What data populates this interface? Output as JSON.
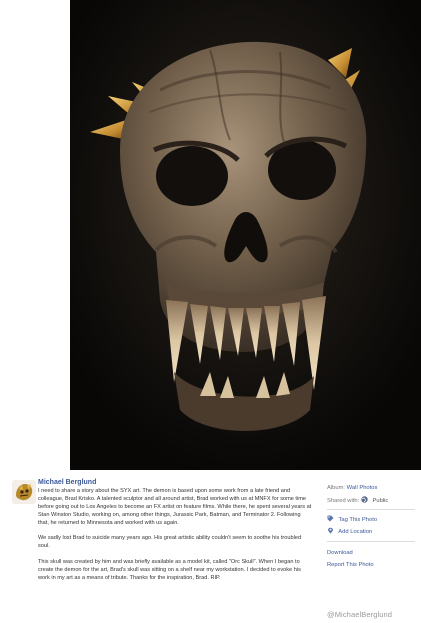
{
  "post": {
    "author": "Michael Berglund",
    "paragraphs": [
      "I need to share a story about the SYX art. The demon is based upon some work from a late friend and colleague, Brad Krisko. A talented sculptor and all around artist, Brad worked with us at MNFX for some time before going out to Los Angeles to become an FX artist on feature films. While there, he spent several years at Stan Winston Studio, working on, among other things, Jurassic Park, Batman, and Terminator 2. Following that, he returned to Minnesota and worked with us again.",
      "We sadly lost Brad to suicide many years ago. His great artistic ability couldn't seem to soothe his troubled soul.",
      "This skull was created by him and was briefly available as a model kit, called \"Orc Skull\". When I began to create the demon for the art, Brad's skull was sitting on a shelf near my workstation. I decided to evoke his work in my art as a means of tribute. Thanks for the inspiration, Brad. RIP."
    ]
  },
  "sidebar": {
    "album_label": "Album:",
    "album_value": "Wall Photos",
    "shared_label": "Shared with:",
    "shared_value": "Public",
    "tag_photo": "Tag This Photo",
    "add_location": "Add Location",
    "download": "Download",
    "report": "Report This Photo"
  },
  "watermark": "@MichaelBerglund",
  "icons": {
    "globe": "globe-icon",
    "tag": "tag-icon",
    "location": "location-pin-icon"
  },
  "colors": {
    "link": "#3b5998",
    "photo_background": "#0c0a09"
  }
}
